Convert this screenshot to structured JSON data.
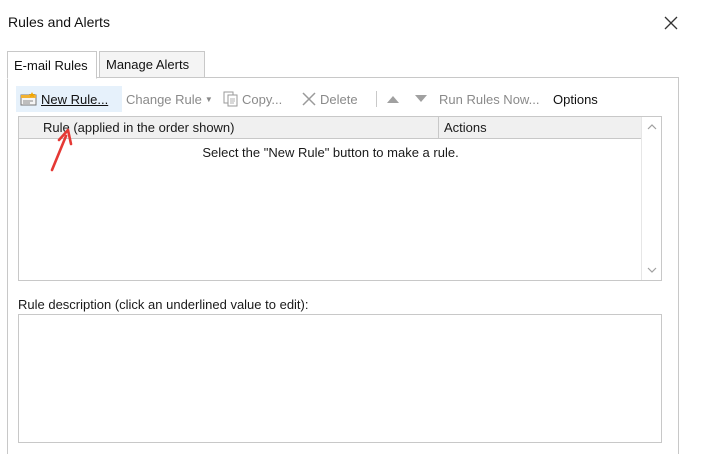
{
  "window": {
    "title": "Rules and Alerts",
    "close_icon": "close-icon"
  },
  "tabs": [
    {
      "label": "E-mail Rules",
      "active": true
    },
    {
      "label": "Manage Alerts",
      "active": false
    }
  ],
  "toolbar": {
    "new_rule": "New Rule...",
    "change_rule": "Change Rule",
    "copy": "Copy...",
    "delete": "Delete",
    "run_rules_now": "Run Rules Now...",
    "options": "Options",
    "icons": {
      "new_rule": "new-rule-icon",
      "copy": "copy-icon",
      "delete": "delete-x-icon",
      "move_up": "triangle-up-icon",
      "move_down": "triangle-down-icon"
    }
  },
  "rules_list": {
    "columns": [
      "Rule (applied in the order shown)",
      "Actions"
    ],
    "rows": [],
    "empty_message": "Select the \"New Rule\" button to make a rule."
  },
  "description": {
    "label": "Rule description (click an underlined value to edit):",
    "text": ""
  },
  "annotation": {
    "color": "#e53935",
    "icon": "red-arrow-annotation"
  },
  "colors": {
    "highlight": "#e6f1fb",
    "border": "#c8c8c8",
    "disabled_text": "#8a8a8a"
  }
}
